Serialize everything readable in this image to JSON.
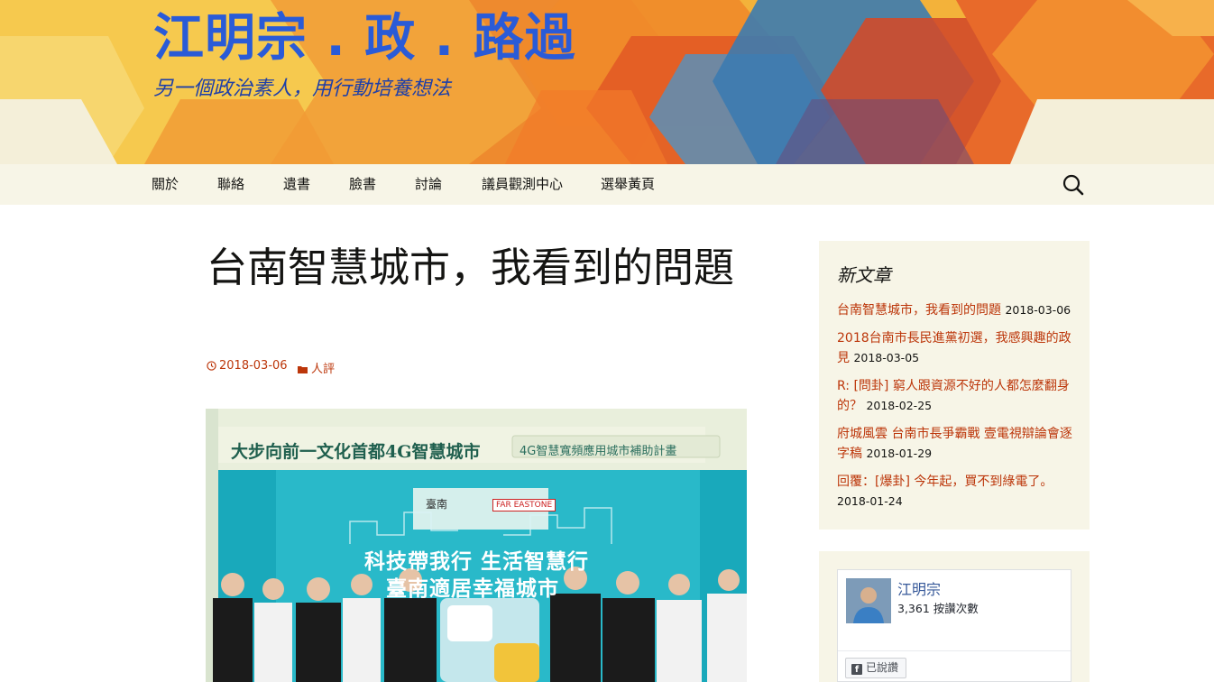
{
  "site": {
    "title": "江明宗 . 政 . 路過",
    "description": "另一個政治素人，用行動培養想法"
  },
  "nav": {
    "items": [
      "關於",
      "聯絡",
      "遺書",
      "臉書",
      "討論",
      "議員觀測中心",
      "選舉黃頁"
    ],
    "search_icon": "search-icon"
  },
  "article": {
    "title": "台南智慧城市，我看到的問題",
    "date": "2018-03-06",
    "category": "人評",
    "image": {
      "banner_left": "大步向前一文化首都4G智慧城市",
      "banner_right": "4G智慧寬頻應用城市補助計畫",
      "slogan_1": "科技帶我行  生活智慧行",
      "slogan_2": "臺南適居幸福城市",
      "logo_1": "臺南",
      "logo_2": "FAR EASTONE"
    }
  },
  "sidebar": {
    "recent_title": "新文章",
    "recent_posts": [
      {
        "title": "台南智慧城市，我看到的問題",
        "date": "2018-03-06"
      },
      {
        "title": "2018台南市長民進黨初選，我感興趣的政見",
        "date": "2018-03-05"
      },
      {
        "title": "R: [問卦] 窮人跟資源不好的人都怎麼翻身的？",
        "date": "2018-02-25"
      },
      {
        "title": "府城風雲 台南市長爭霸戰 壹電視辯論會逐字稿",
        "date": "2018-01-29"
      },
      {
        "title": "回覆：[爆卦] 今年起，買不到綠電了。",
        "date": "2018-01-24"
      }
    ],
    "facebook": {
      "name": "江明宗",
      "likes": "3,361 按讚次數",
      "like_button": "已說讚"
    }
  },
  "colors": {
    "accent": "#bc360a",
    "title_blue": "#2a5bd7",
    "nav_bg": "#f7f5e7"
  }
}
